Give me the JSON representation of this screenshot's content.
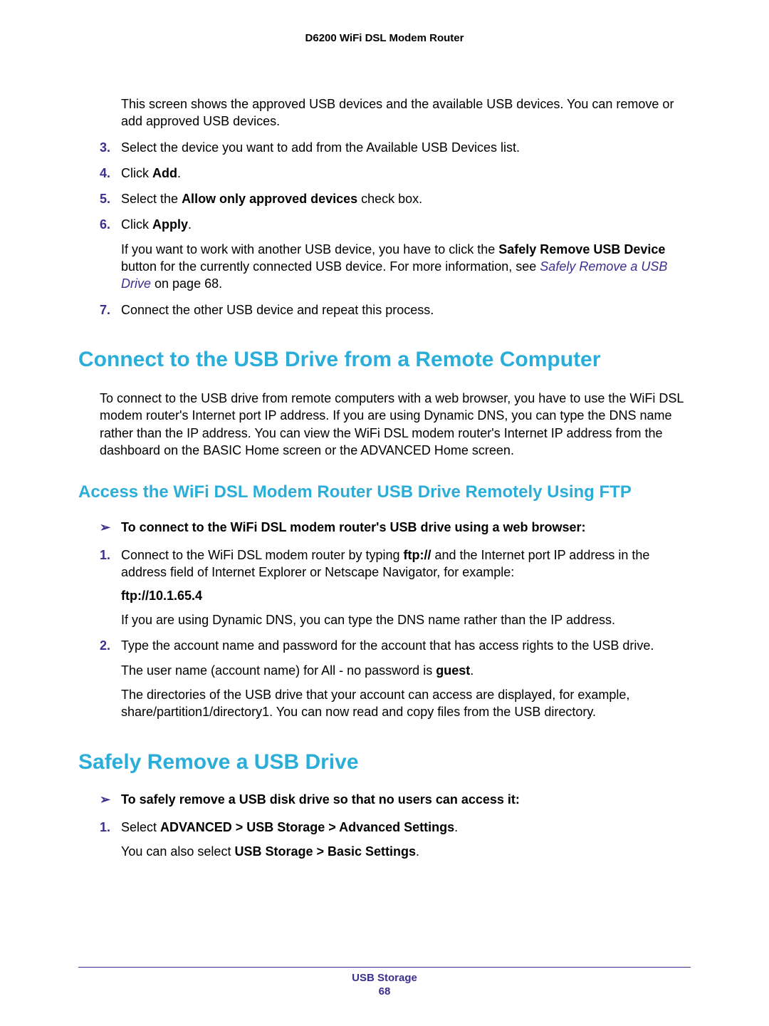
{
  "header": {
    "title": "D6200 WiFi DSL Modem Router"
  },
  "intro_para": "This screen shows the approved USB devices and the available USB devices. You can remove or add approved USB devices.",
  "steps_a": {
    "s3": {
      "num": "3.",
      "text": "Select the device you want to add from the Available USB Devices list."
    },
    "s4": {
      "num": "4.",
      "pre": "Click ",
      "bold": "Add",
      "post": "."
    },
    "s5": {
      "num": "5.",
      "pre": "Select the ",
      "bold": "Allow only approved devices",
      "post": " check box."
    },
    "s6": {
      "num": "6.",
      "pre": "Click ",
      "bold": "Apply",
      "post": ".",
      "sub_pre": "If you want to work with another USB device, you have to click the ",
      "sub_bold": "Safely Remove USB Device",
      "sub_mid": " button for the currently connected USB device. For more information, see ",
      "sub_link": "Safely Remove a USB Drive",
      "sub_post": " on page 68."
    },
    "s7": {
      "num": "7.",
      "text": "Connect the other USB device and repeat this process."
    }
  },
  "h1_a": "Connect to the USB Drive from a Remote Computer",
  "para_a": "To connect to the USB drive from remote computers with a web browser, you have to use the WiFi DSL modem router's Internet port IP address. If you are using Dynamic DNS, you can type the DNS name rather than the IP address. You can view the WiFi DSL modem router's Internet IP address from the dashboard on the BASIC Home screen or the ADVANCED Home screen.",
  "h2_a": "Access the WiFi DSL Modem Router USB Drive Remotely Using FTP",
  "procedure_a": {
    "arrow": "➢",
    "text": "To connect to the WiFi DSL modem router's USB drive using a web browser:"
  },
  "steps_b": {
    "s1": {
      "num": "1.",
      "pre": "Connect to the WiFi DSL modem router by typing ",
      "bold": "ftp://",
      "post": " and the Internet port IP address in the address field of Internet Explorer or Netscape Navigator, for example:",
      "sample": "ftp://10.1.65.4",
      "sub": "If you are using Dynamic DNS, you can type the DNS name rather than the IP address."
    },
    "s2": {
      "num": "2.",
      "text": "Type the account name and password for the account that has access rights to the USB drive.",
      "sub1_pre": "The user name (account name) for All - no password is ",
      "sub1_bold": "guest",
      "sub1_post": ".",
      "sub2": "The directories of the USB drive that your account can access are displayed, for example, share/partition1/directory1. You can now read and copy files from the USB directory."
    }
  },
  "h1_b": "Safely Remove a USB Drive",
  "procedure_b": {
    "arrow": "➢",
    "text": "To safely remove a USB disk drive so that no users can access it:"
  },
  "steps_c": {
    "s1": {
      "num": "1.",
      "pre": "Select ",
      "bold": "ADVANCED > USB Storage > Advanced Settings",
      "post": ".",
      "sub_pre": "You can also select ",
      "sub_bold": "USB Storage > Basic Settings",
      "sub_post": "."
    }
  },
  "footer": {
    "chapter": "USB Storage",
    "page": "68"
  }
}
